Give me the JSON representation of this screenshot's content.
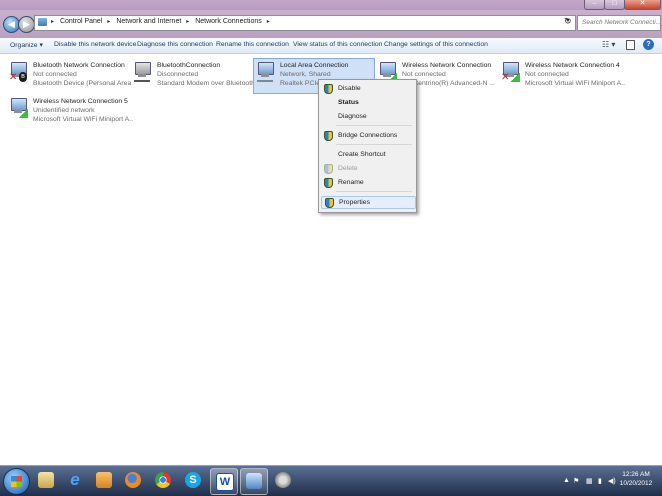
{
  "window": {
    "min": "–",
    "max": "□",
    "close": "✕"
  },
  "address": {
    "crumbs": [
      "Control Panel",
      "Network and Internet",
      "Network Connections"
    ],
    "search_placeholder": "Search Network Connecti..."
  },
  "toolbar": {
    "organize": "Organize ▾",
    "items": [
      "Disable this network device",
      "Diagnose this connection",
      "Rename this connection",
      "View status of this connection",
      "Change settings of this connection"
    ]
  },
  "connections": [
    {
      "name": "Bluetooth Network Connection",
      "status": "Not connected",
      "device": "Bluetooth Device (Personal Area ...",
      "badge": "x-bluetooth"
    },
    {
      "name": "BluetoothConnection",
      "status": "Disconnected",
      "device": "Standard Modem over Bluetooth ...",
      "badge": "modem"
    },
    {
      "name": "Local Area Connection",
      "status": "Network, Shared",
      "device": "Realtek PCIe GB",
      "badge": "cable",
      "selected": true
    },
    {
      "name": "Wireless Network Connection",
      "status": "Not connected",
      "device": "(R) Centrino(R) Advanced-N ...",
      "badge": "signal"
    },
    {
      "name": "Wireless Network Connection 4",
      "status": "Not connected",
      "device": "Microsoft Virtual WiFi Miniport A...",
      "badge": "x-signal"
    },
    {
      "name": "Wireless Network Connection 5",
      "status": "Unidentified network",
      "device": "Microsoft Virtual WiFi Miniport A...",
      "badge": "signal"
    }
  ],
  "context_menu": {
    "items": [
      {
        "label": "Disable",
        "shield": true
      },
      {
        "label": "Status",
        "bold": true
      },
      {
        "label": "Diagnose"
      },
      {
        "label": "Bridge Connections",
        "shield": true
      },
      {
        "label": "Create Shortcut"
      },
      {
        "label": "Delete",
        "disabled": true,
        "shield": true
      },
      {
        "label": "Rename",
        "shield": true
      },
      {
        "label": "Properties",
        "shield": true,
        "highlighted": true
      }
    ]
  },
  "taskbar": {
    "apps": [
      "start-orb",
      "explorer",
      "internet-explorer",
      "network-app",
      "firefox",
      "chrome",
      "skype",
      "word",
      "network-connections",
      "utility"
    ],
    "clock_time": "12:26 AM",
    "clock_date": "10/20/2012"
  }
}
